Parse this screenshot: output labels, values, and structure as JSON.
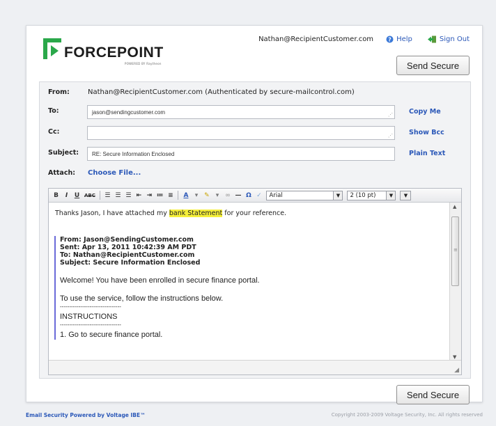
{
  "header": {
    "brand": "FORCEPOINT",
    "brand_sub": "POWERED BY Raytheon",
    "user_email": "Nathan@RecipientCustomer.com",
    "help": "Help",
    "sign_out": "Sign Out"
  },
  "buttons": {
    "send_secure": "Send Secure"
  },
  "form": {
    "from_label": "From:",
    "from_value": "Nathan@RecipientCustomer.com (Authenticated by secure-mailcontrol.com)",
    "to_label": "To:",
    "to_value": "jason@sendingcustomer.com",
    "cc_label": "Cc:",
    "cc_value": "",
    "subject_label": "Subject:",
    "subject_value": "RE: Secure Information Enclosed",
    "attach_label": "Attach:",
    "choose_file": "Choose File...",
    "copy_me": "Copy Me",
    "show_bcc": "Show Bcc",
    "plain_text": "Plain Text"
  },
  "editor": {
    "font": "Arial",
    "size": "2 (10 pt)",
    "reply_pre": "Thanks Jason, I have attached my ",
    "reply_highlight": "bank Statement",
    "reply_post": " for your reference.",
    "quote_from": "From: Jason@SendingCustomer.com",
    "quote_sent": "Sent: Apr 13, 2011 10:42:39 AM PDT",
    "quote_to": "To: Nathan@RecipientCustomer.com",
    "quote_subject": "Subject: Secure Information Enclosed",
    "body1": "Welcome! You have been enrolled in secure finance portal.",
    "body2": "To use the service, follow the instructions below.",
    "dashes1": "---------------------------------",
    "instructions": "INSTRUCTIONS",
    "dashes2": "---------------------------------",
    "step1": "1. Go to secure finance portal."
  },
  "footer": {
    "left": "Email Security Powered by Voltage IBE™",
    "right": "Copyright 2003-2009 Voltage Security, Inc. All rights reserved"
  },
  "colors": {
    "link": "#2b58b8",
    "brand_green": "#2aa84a",
    "highlight": "#f5ef3a"
  }
}
